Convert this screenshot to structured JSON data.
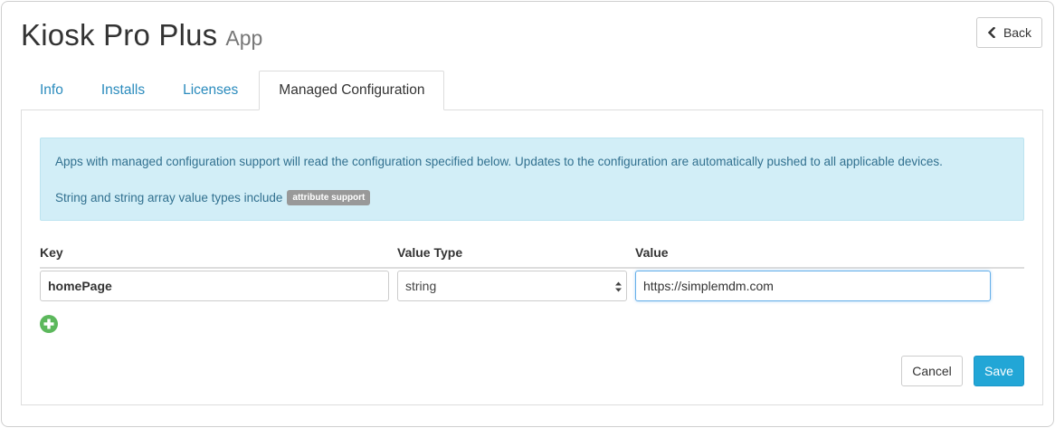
{
  "header": {
    "title": "Kiosk Pro Plus",
    "subtitle": "App",
    "back_label": "Back",
    "back_icon": "chevron-left-icon"
  },
  "tabs": [
    {
      "label": "Info",
      "active": false
    },
    {
      "label": "Installs",
      "active": false
    },
    {
      "label": "Licenses",
      "active": false
    },
    {
      "label": "Managed Configuration",
      "active": true
    }
  ],
  "alert": {
    "message": "Apps with managed configuration support will read the configuration specified below. Updates to the configuration are automatically pushed to all applicable devices.",
    "note": "String and string array value types include",
    "badge": "attribute support"
  },
  "table": {
    "columns": [
      "Key",
      "Value Type",
      "Value"
    ],
    "rows": [
      {
        "key": "homePage",
        "value_type": "string",
        "value": "https://simplemdm.com"
      }
    ]
  },
  "actions": {
    "add_icon": "plus-circle-icon",
    "cancel_label": "Cancel",
    "save_label": "Save"
  },
  "colors": {
    "link": "#2a8bbd",
    "alert_bg": "#d2eef7",
    "alert_text": "#31708f",
    "badge_bg": "#999999",
    "add_green": "#5cb85c",
    "save_bg": "#22a6d6"
  }
}
